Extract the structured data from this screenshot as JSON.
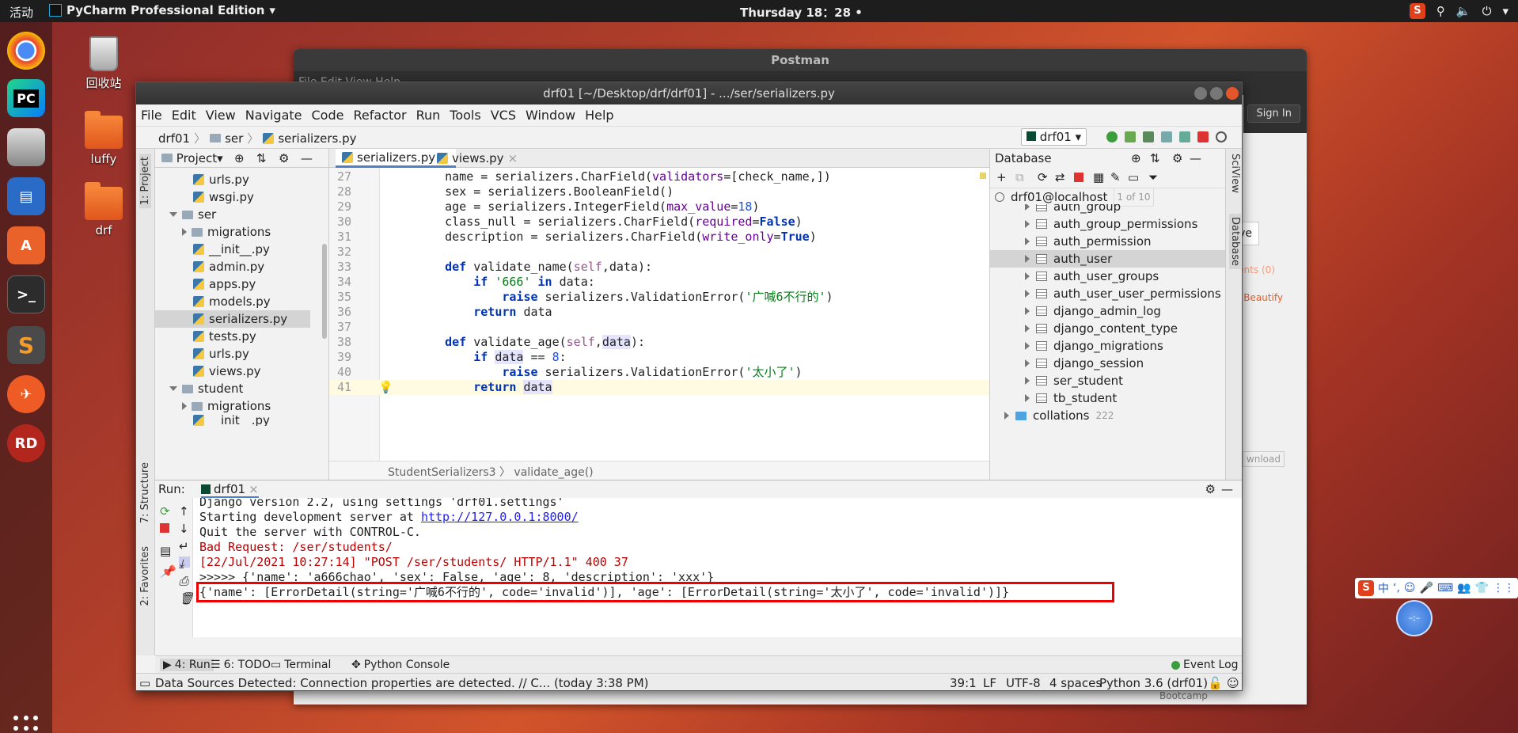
{
  "topbar": {
    "activities": "活动",
    "app_name": "PyCharm Professional Edition",
    "clock": "Thursday 18：28"
  },
  "desktop": {
    "icons": [
      {
        "label": "回收站"
      },
      {
        "label": "luffy"
      },
      {
        "label": "drf"
      }
    ]
  },
  "postman": {
    "title": "Postman",
    "menu": "File  Edit  View  Help",
    "sign_in": "Sign In",
    "frag_ve": "ve",
    "frag_comments": "ments (0)",
    "frag_beautify": "Beautify",
    "frag_download": "wnload",
    "frag_bootcamp": "Bootcamp"
  },
  "pycharm": {
    "title": "drf01 [~/Desktop/drf/drf01] - .../ser/serializers.py",
    "menu": [
      "File",
      "Edit",
      "View",
      "Navigate",
      "Code",
      "Refactor",
      "Run",
      "Tools",
      "VCS",
      "Window",
      "Help"
    ],
    "nav": {
      "project": "drf01",
      "folder": "ser",
      "file": "serializers.py",
      "run_config": "drf01"
    },
    "left_strip": {
      "project": "1: Project",
      "structure": "7: Structure",
      "favorites": "2: Favorites"
    },
    "project_panel": {
      "header": "Project",
      "items": [
        {
          "label": "urls.py"
        },
        {
          "label": "wsgi.py"
        },
        {
          "label": "ser"
        },
        {
          "label": "migrations"
        },
        {
          "label": "__init__.py"
        },
        {
          "label": "admin.py"
        },
        {
          "label": "apps.py"
        },
        {
          "label": "models.py"
        },
        {
          "label": "serializers.py"
        },
        {
          "label": "tests.py"
        },
        {
          "label": "urls.py"
        },
        {
          "label": "views.py"
        },
        {
          "label": "student"
        },
        {
          "label": "migrations"
        },
        {
          "label": "__init__.py"
        }
      ]
    },
    "editor": {
      "tabs": [
        "serializers.py",
        "views.py"
      ],
      "line_numbers": [
        "27",
        "28",
        "29",
        "30",
        "31",
        "32",
        "33",
        "34",
        "35",
        "36",
        "37",
        "38",
        "39",
        "40",
        "41"
      ],
      "breadcrumb": "StudentSerializers3 〉 validate_age()"
    },
    "database": {
      "header": "Database",
      "connection": "drf01@localhost",
      "connection_badge": "1 of 10",
      "tables": [
        "auth_group",
        "auth_group_permissions",
        "auth_permission",
        "auth_user",
        "auth_user_groups",
        "auth_user_user_permissions",
        "django_admin_log",
        "django_content_type",
        "django_migrations",
        "django_session",
        "ser_student",
        "tb_student"
      ],
      "collations": "collations",
      "collations_count": "222"
    },
    "right_strip": {
      "sciview": "SciView",
      "database": "Database"
    },
    "run": {
      "label": "Run:",
      "tab": "drf01",
      "lines": [
        "Django version 2.2, using settings 'drf01.settings'",
        "Starting development server at ",
        "http://127.0.0.1:8000/",
        "Quit the server with CONTROL-C.",
        "Bad Request: /ser/students/",
        "[22/Jul/2021 10:27:14] \"POST /ser/students/ HTTP/1.1\" 400 37",
        ">>>>> {'name': 'a666chao', 'sex': False, 'age': 8, 'description': 'xxx'}",
        "{'name': [ErrorDetail(string='广喊6不行的', code='invalid')], 'age': [ErrorDetail(string='太小了', code='invalid')]}"
      ]
    },
    "bottom_tabs": [
      "4: Run",
      "6: TODO",
      "Terminal",
      "Python Console",
      "Event Log"
    ],
    "status": {
      "message": "Data Sources Detected: Connection properties are detected. // C... (today 3:38 PM)",
      "position": "39:1",
      "line_sep": "LF",
      "encoding": "UTF-8",
      "indent": "4 spaces",
      "interpreter": "Python 3.6 (drf01)"
    }
  },
  "sogou": {
    "lang": "中",
    "punct": "ʻ,"
  }
}
